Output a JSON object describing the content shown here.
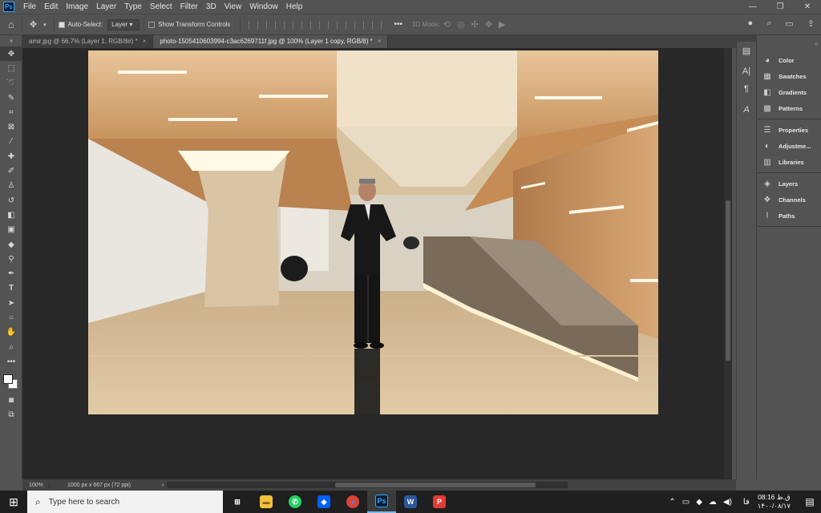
{
  "app": {
    "logo_text": "Ps",
    "menu": [
      "File",
      "Edit",
      "Image",
      "Layer",
      "Type",
      "Select",
      "Filter",
      "3D",
      "View",
      "Window",
      "Help"
    ],
    "window_controls": [
      "—",
      "❐",
      "✕"
    ]
  },
  "options_bar": {
    "auto_select_label": "Auto-Select:",
    "auto_select_checked": true,
    "layer_dropdown": "Layer",
    "show_transform_label": "Show Transform Controls",
    "show_transform_checked": false,
    "more_label": "•••",
    "mode_3d_label": "3D Mode:"
  },
  "tabs": [
    {
      "title": "amir.jpg @ 66.7% (Layer 1, RGB/8#) *",
      "active": false
    },
    {
      "title": "photo-1505410603994-c3ac6269711f.jpg @ 100% (Layer 1 copy, RGB/8) *",
      "active": true
    }
  ],
  "status": {
    "zoom": "100%",
    "doc_info": "1000 px x 667 px (72 ppi)"
  },
  "panels": {
    "group1": [
      {
        "label": "Color",
        "icon": "color-wheel-icon"
      },
      {
        "label": "Swatches",
        "icon": "swatches-icon"
      },
      {
        "label": "Gradients",
        "icon": "gradient-icon"
      },
      {
        "label": "Patterns",
        "icon": "patterns-icon"
      }
    ],
    "group2": [
      {
        "label": "Properties",
        "icon": "sliders-icon"
      },
      {
        "label": "Adjustme...",
        "icon": "adjustments-icon"
      },
      {
        "label": "Libraries",
        "icon": "library-icon"
      }
    ],
    "group3": [
      {
        "label": "Layers",
        "icon": "layers-icon"
      },
      {
        "label": "Channels",
        "icon": "channels-icon"
      },
      {
        "label": "Paths",
        "icon": "paths-icon"
      }
    ]
  },
  "taskbar": {
    "search_placeholder": "Type here to search",
    "apps": [
      {
        "name": "task-view",
        "label": "⊞",
        "color": "#1f1f1f"
      },
      {
        "name": "file-explorer",
        "label": "▬",
        "color": "#f2c23c"
      },
      {
        "name": "whatsapp",
        "label": "✆",
        "color": "#25d366"
      },
      {
        "name": "dropbox",
        "label": "◆",
        "color": "#0061ff"
      },
      {
        "name": "chrome",
        "label": "●",
        "color": "#db4437"
      },
      {
        "name": "photoshop",
        "label": "Ps",
        "color": "#001e36"
      },
      {
        "name": "word",
        "label": "W",
        "color": "#2b579a"
      },
      {
        "name": "psiphon",
        "label": "P",
        "color": "#e53935"
      }
    ],
    "tray_lang": "فا",
    "clock_time": "08:16 ق.ظ",
    "clock_date": "۱۴۰۰/۰۸/۱۷"
  }
}
